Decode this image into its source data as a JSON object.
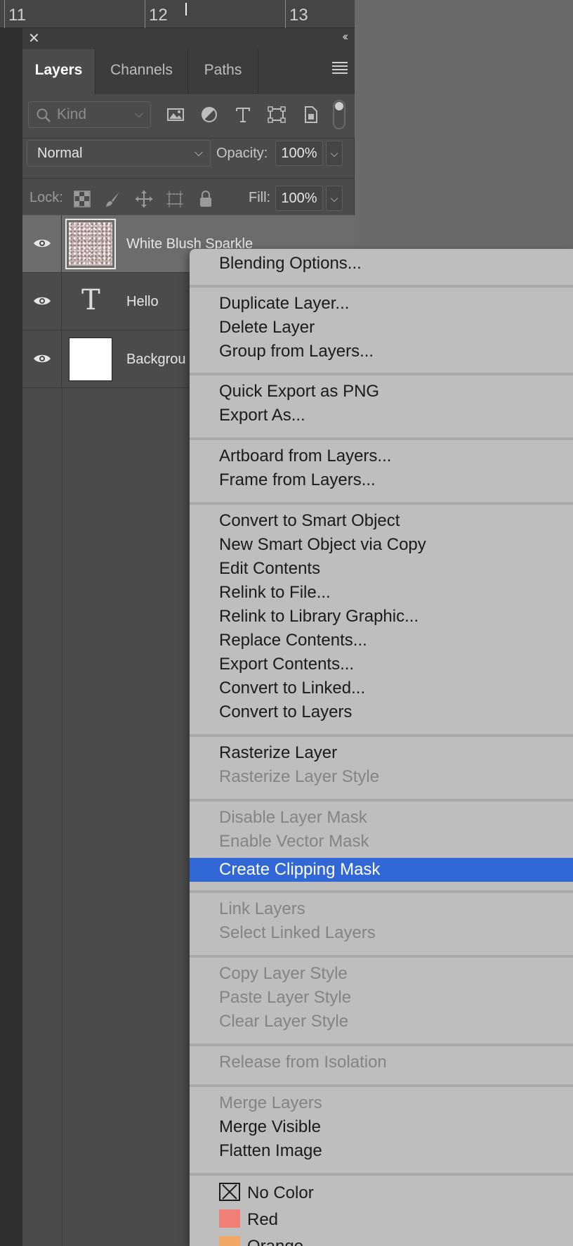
{
  "ruler": {
    "marks": [
      "11",
      "12",
      "13"
    ]
  },
  "panel": {
    "tabs": [
      {
        "label": "Layers",
        "active": true
      },
      {
        "label": "Channels",
        "active": false
      },
      {
        "label": "Paths",
        "active": false
      }
    ],
    "filter": {
      "kind_placeholder": "Kind"
    },
    "blend": {
      "mode": "Normal",
      "opacity_label": "Opacity:",
      "opacity_value": "100%"
    },
    "lock": {
      "label": "Lock:",
      "fill_label": "Fill:",
      "fill_value": "100%"
    },
    "layers": [
      {
        "name": "White Blush Sparkle",
        "type": "image",
        "selected": true
      },
      {
        "name": "Hello",
        "type": "text",
        "selected": false
      },
      {
        "name": "Backgrou",
        "type": "background",
        "selected": false
      }
    ]
  },
  "context_menu": {
    "items": {
      "blending_options": "Blending Options...",
      "duplicate_layer": "Duplicate Layer...",
      "delete_layer": "Delete Layer",
      "group_from_layers": "Group from Layers...",
      "quick_export_png": "Quick Export as PNG",
      "export_as": "Export As...",
      "artboard_from_layers": "Artboard from Layers...",
      "frame_from_layers": "Frame from Layers...",
      "convert_smart_object": "Convert to Smart Object",
      "new_smart_object_copy": "New Smart Object via Copy",
      "edit_contents": "Edit Contents",
      "relink_to_file": "Relink to File...",
      "relink_library_graphic": "Relink to Library Graphic...",
      "replace_contents": "Replace Contents...",
      "export_contents": "Export Contents...",
      "convert_to_linked": "Convert to Linked...",
      "convert_to_layers": "Convert to Layers",
      "rasterize_layer": "Rasterize Layer",
      "rasterize_layer_style": "Rasterize Layer Style",
      "disable_layer_mask": "Disable Layer Mask",
      "enable_vector_mask": "Enable Vector Mask",
      "create_clipping_mask": "Create Clipping Mask",
      "link_layers": "Link Layers",
      "select_linked_layers": "Select Linked Layers",
      "copy_layer_style": "Copy Layer Style",
      "paste_layer_style": "Paste Layer Style",
      "clear_layer_style": "Clear Layer Style",
      "release_isolation": "Release from Isolation",
      "merge_layers": "Merge Layers",
      "merge_visible": "Merge Visible",
      "flatten_image": "Flatten Image",
      "no_color": "No Color",
      "red": "Red",
      "orange": "Orange"
    },
    "colors": {
      "red_swatch": "#ef7f77",
      "orange_swatch": "#f2a865",
      "highlight": "#3267d6"
    }
  }
}
